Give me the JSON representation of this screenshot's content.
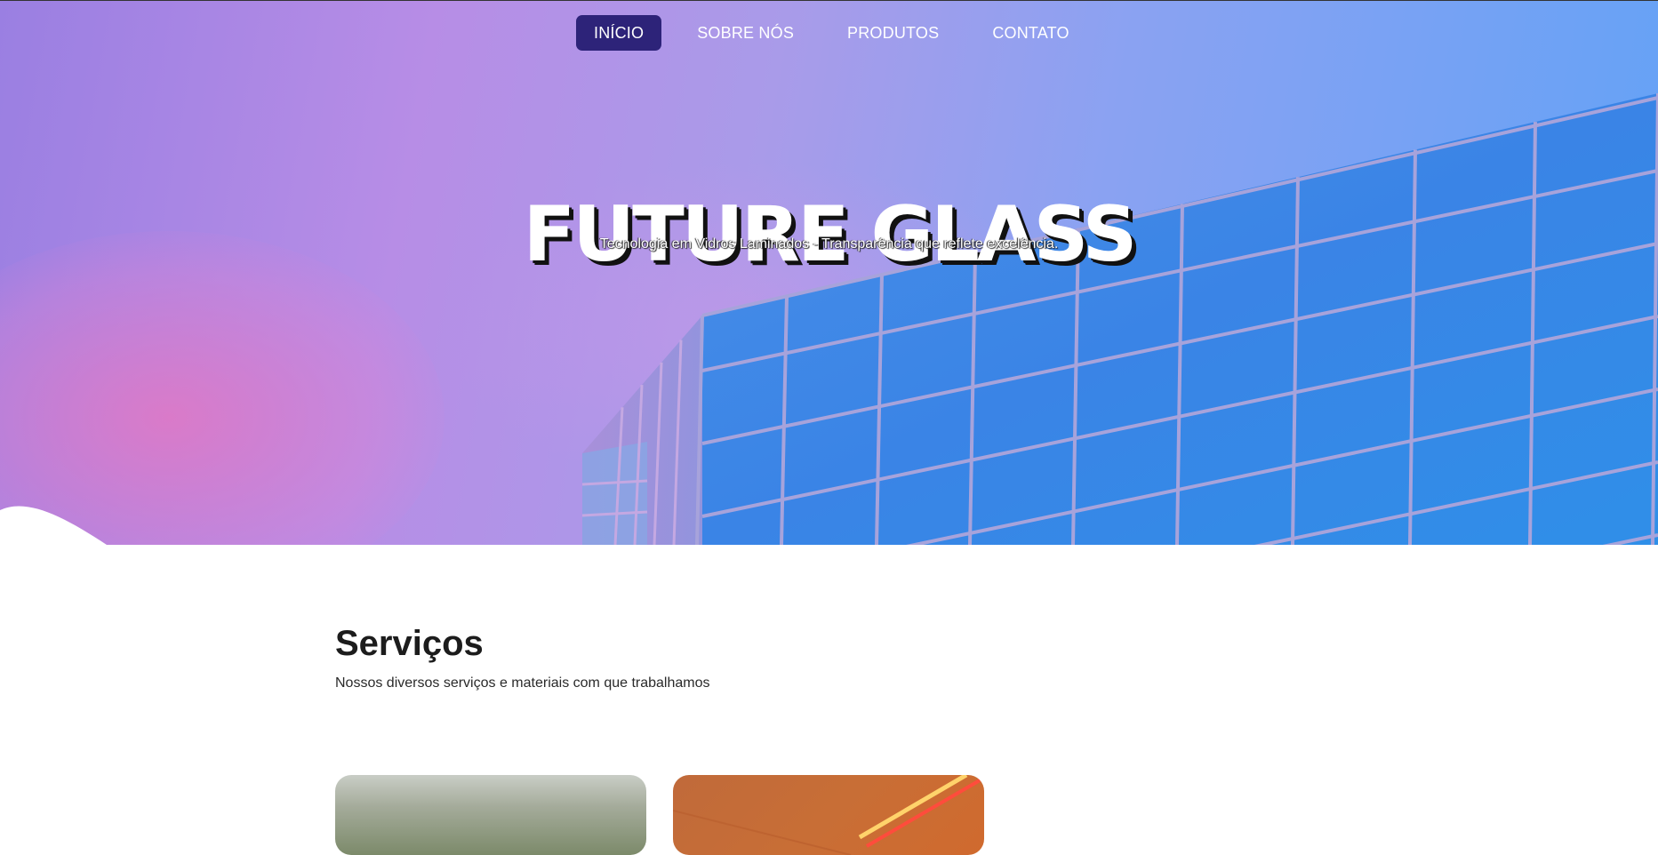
{
  "nav": {
    "items": [
      {
        "label": "INÍCIO",
        "active": true
      },
      {
        "label": "SOBRE NÓS",
        "active": false
      },
      {
        "label": "PRODUTOS",
        "active": false
      },
      {
        "label": "CONTATO",
        "active": false
      }
    ]
  },
  "hero": {
    "title": "FUTURE GLASS",
    "subtitle": "Tecnologia em Vidros Laminados - Transparência que reflete excelência."
  },
  "services": {
    "title": "Serviços",
    "description": "Nossos diversos serviços e materiais com que trabalhamos"
  },
  "colors": {
    "nav_active_bg": "#2d2379",
    "glass_blue": "#3f86e6",
    "frame_lavender": "#9aa0d8"
  }
}
